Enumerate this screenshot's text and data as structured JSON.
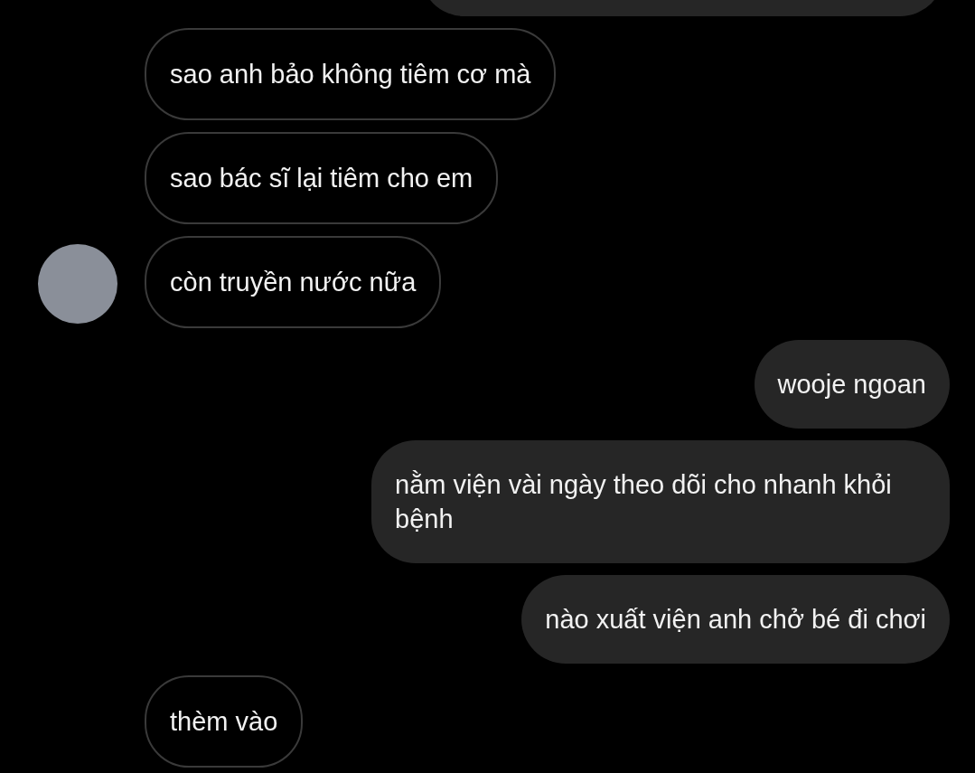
{
  "messages": [
    {
      "kind": "received",
      "text": "sao anh bảo không tiêm cơ mà",
      "avatar": false
    },
    {
      "kind": "received",
      "text": "sao bác sĩ lại tiêm cho em",
      "avatar": false
    },
    {
      "kind": "received",
      "text": "còn truyền nước nữa",
      "avatar": true
    },
    {
      "kind": "sent",
      "text": "wooje ngoan"
    },
    {
      "kind": "sent",
      "text": "nằm viện vài ngày theo dõi cho nhanh khỏi bệnh"
    },
    {
      "kind": "sent",
      "text": "nào xuất viện anh chở bé đi chơi"
    },
    {
      "kind": "received",
      "text": "thèm vào",
      "avatar": false
    }
  ]
}
